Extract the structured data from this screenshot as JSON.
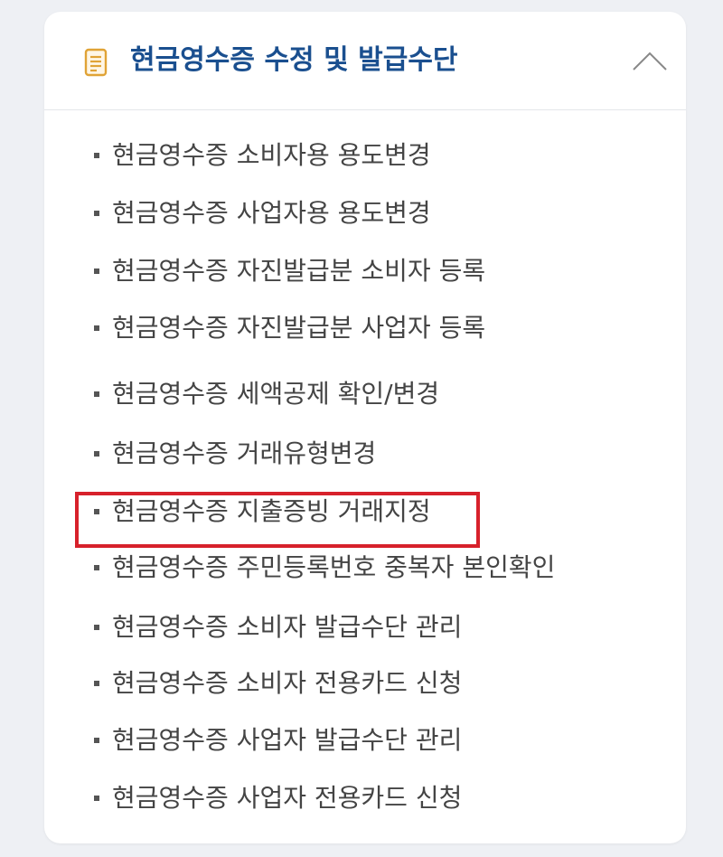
{
  "section": {
    "title": "현금영수증 수정 및 발급수단",
    "icon": "document-icon",
    "toggle_icon": "chevron-up-icon"
  },
  "menu": {
    "items": [
      {
        "label": "현금영수증 소비자용 용도변경"
      },
      {
        "label": "현금영수증 사업자용 용도변경"
      },
      {
        "label": "현금영수증 자진발급분 소비자 등록"
      },
      {
        "label": "현금영수증 자진발급분 사업자 등록"
      },
      {
        "label": "현금영수증 세액공제 확인/변경"
      },
      {
        "label": "현금영수증 거래유형변경"
      },
      {
        "label": "현금영수증 지출증빙 거래지정"
      },
      {
        "label": "현금영수증 주민등록번호 중복자 본인확인"
      },
      {
        "label": "현금영수증 소비자 발급수단 관리"
      },
      {
        "label": "현금영수증 소비자 전용카드 신청"
      },
      {
        "label": "현금영수증 사업자 발급수단 관리"
      },
      {
        "label": "현금영수증 사업자 전용카드 신청"
      }
    ]
  },
  "colors": {
    "title": "#1a4f8f",
    "icon": "#e0a336",
    "highlight": "#d7212b",
    "text": "#444444"
  }
}
